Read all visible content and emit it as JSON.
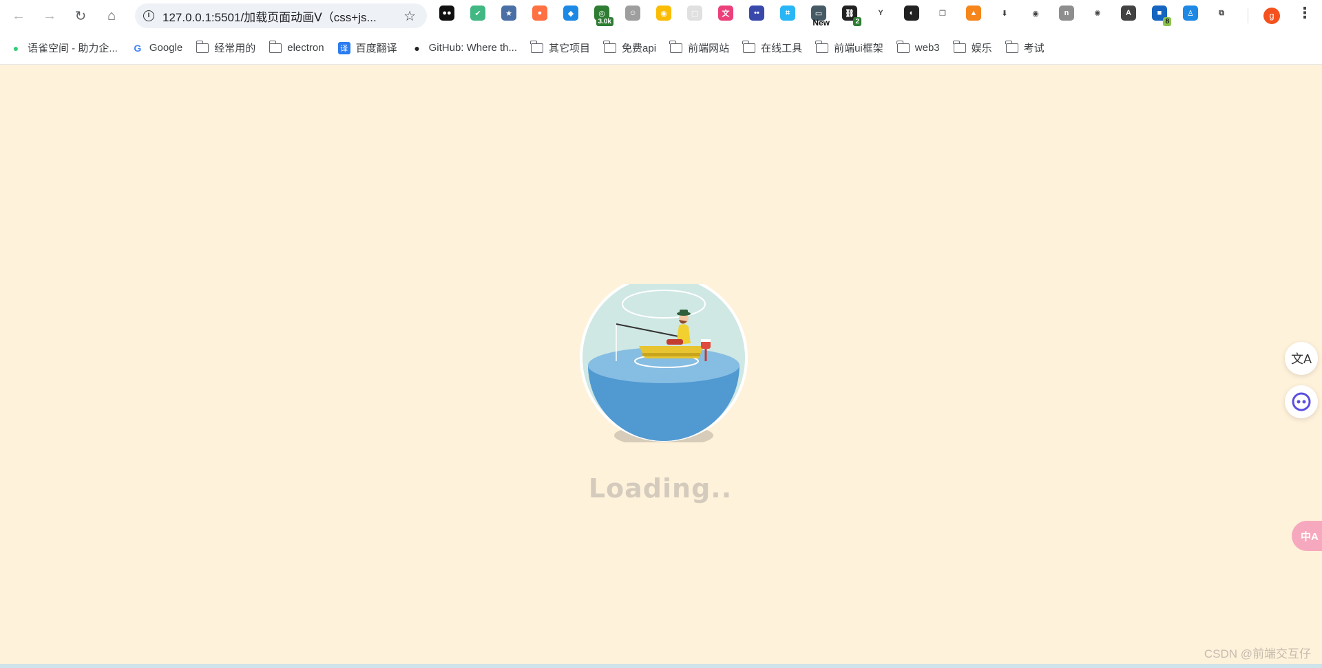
{
  "toolbar": {
    "url": "127.0.0.1:5501/加载页面动画Ⅴ（css+js...",
    "profile_initial": "g",
    "extensions": [
      {
        "name": "ext-ghost-icon",
        "bg": "#111111",
        "glyph": "●●"
      },
      {
        "name": "ext-vue-devtools-icon",
        "bg": "#41b883",
        "glyph": "✔"
      },
      {
        "name": "ext-star-icon",
        "bg": "#4a6fa5",
        "glyph": "★"
      },
      {
        "name": "ext-orange-icon",
        "bg": "#ff7043",
        "glyph": "●"
      },
      {
        "name": "ext-shield-icon",
        "bg": "#1e88e5",
        "glyph": "◆"
      },
      {
        "name": "ext-counter-icon",
        "bg": "#2e7d32",
        "glyph": "◎",
        "badge": "3.0k"
      },
      {
        "name": "ext-cat-icon",
        "bg": "#9e9e9e",
        "glyph": "☺"
      },
      {
        "name": "ext-chrome-color-icon",
        "bg": "#fbbc05",
        "glyph": "◉"
      },
      {
        "name": "ext-blank-icon",
        "bg": "#e0e0e0",
        "glyph": "▢"
      },
      {
        "name": "ext-translate-pink-icon",
        "bg": "#ec407a",
        "glyph": "文"
      },
      {
        "name": "ext-monica-icon",
        "bg": "#3949ab",
        "glyph": "••"
      },
      {
        "name": "ext-screenshot-icon",
        "bg": "#29b6f6",
        "glyph": "⌗"
      },
      {
        "name": "ext-new-icon",
        "bg": "#455a64",
        "glyph": "▭",
        "badge": "New"
      },
      {
        "name": "ext-link-icon",
        "bg": "#212121",
        "glyph": "⛓",
        "badge": "2"
      },
      {
        "name": "ext-y-icon",
        "bg": "#ffffff",
        "glyph": "Y"
      },
      {
        "name": "ext-color-wheel-icon",
        "bg": "#212121",
        "glyph": "◐"
      },
      {
        "name": "ext-copy-icon",
        "bg": "#ffffff",
        "glyph": "❐"
      },
      {
        "name": "ext-metamask-icon",
        "bg": "#f6851b",
        "glyph": "▲"
      },
      {
        "name": "ext-download-icon",
        "bg": "#ffffff",
        "glyph": "⬇"
      },
      {
        "name": "ext-eye-icon",
        "bg": "#ffffff",
        "glyph": "◉"
      },
      {
        "name": "ext-n-icon",
        "bg": "#8e8e8e",
        "glyph": "n"
      },
      {
        "name": "ext-people-icon",
        "bg": "#ffffff",
        "glyph": "✺"
      },
      {
        "name": "ext-a-icon",
        "bg": "#424242",
        "glyph": "A"
      },
      {
        "name": "ext-blue-square-icon",
        "bg": "#1565c0",
        "glyph": "■",
        "badge": "8"
      },
      {
        "name": "ext-person-icon",
        "bg": "#1e88e5",
        "glyph": "♙"
      },
      {
        "name": "ext-puzzle-icon",
        "bg": "#ffffff",
        "glyph": "⧉"
      }
    ]
  },
  "bookmarks": [
    {
      "label": "语雀空间 - 助力企...",
      "icon": "yuque-icon"
    },
    {
      "label": "Google",
      "icon": "google-icon"
    },
    {
      "label": "经常用的",
      "icon": "folder-icon"
    },
    {
      "label": "electron",
      "icon": "folder-icon"
    },
    {
      "label": "百度翻译",
      "icon": "baidu-translate-icon"
    },
    {
      "label": "GitHub: Where th...",
      "icon": "github-icon"
    },
    {
      "label": "其它项目",
      "icon": "folder-icon"
    },
    {
      "label": "免费api",
      "icon": "folder-icon"
    },
    {
      "label": "前端网站",
      "icon": "folder-icon"
    },
    {
      "label": "在线工具",
      "icon": "folder-icon"
    },
    {
      "label": "前端ui框架",
      "icon": "folder-icon"
    },
    {
      "label": "web3",
      "icon": "folder-icon"
    },
    {
      "label": "娱乐",
      "icon": "folder-icon"
    },
    {
      "label": "考试",
      "icon": "folder-icon"
    }
  ],
  "page": {
    "loading_text": "Loading..",
    "watermark": "CSDN @前端交互仔",
    "side_pink_glyph": "中A",
    "colors": {
      "background": "#fff2db",
      "sphere_glass": "#cfe8e4",
      "water_top": "#86bde3",
      "water_body": "#5199d1",
      "boat": "#e7c430",
      "loading_text": "#d4cbbd"
    }
  }
}
